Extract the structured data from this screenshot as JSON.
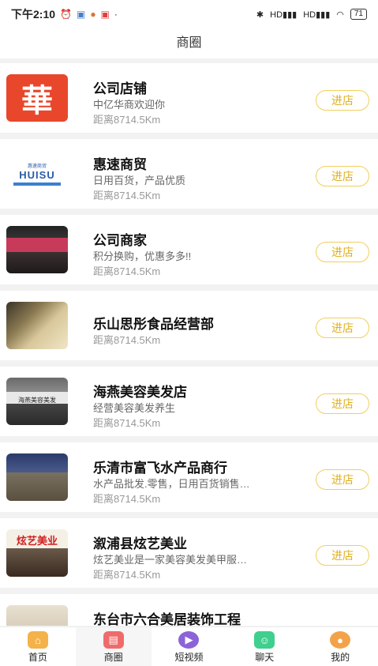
{
  "status_bar": {
    "time": "下午2:10",
    "network": "HD",
    "battery": "71"
  },
  "header": {
    "title": "商圈"
  },
  "stores": [
    {
      "name": "公司店铺",
      "desc": "中亿华商欢迎你",
      "distance": "距离8714.5Km",
      "button": "进店"
    },
    {
      "name": "惠速商贸",
      "desc": "日用百货，产品优质",
      "distance": "距离8714.5Km",
      "button": "进店"
    },
    {
      "name": "公司商家",
      "desc": "积分换购，优惠多多!!",
      "distance": "距离8714.5Km",
      "button": "进店"
    },
    {
      "name": "乐山思彤食品经营部",
      "desc": "",
      "distance": "距离8714.5Km",
      "button": "进店"
    },
    {
      "name": "海燕美容美发店",
      "desc": "经营美容美发养生",
      "distance": "距离8714.5Km",
      "button": "进店"
    },
    {
      "name": "乐清市富飞水产品商行",
      "desc": "水产品批发.零售，日用百货销售…",
      "distance": "距离8714.5Km",
      "button": "进店"
    },
    {
      "name": "溆浦县炫艺美业",
      "desc": "炫艺美业是一家美容美发美甲服…",
      "distance": "距离8714.5Km",
      "button": "进店"
    },
    {
      "name": "东台市六合美居装饰工程",
      "desc": "",
      "distance": "",
      "button": ""
    }
  ],
  "thumb_text": {
    "logo1": "華",
    "logo2_small": "惠速商贸",
    "logo2_big": "HUISU",
    "sign": "炫艺美业",
    "sign2": "海燕美容美发"
  },
  "tabs": [
    {
      "label": "首页",
      "icon": "home-icon",
      "color": "#f4b24a"
    },
    {
      "label": "商圈",
      "icon": "shop-icon",
      "color": "#ef6b6b",
      "active": true
    },
    {
      "label": "短视频",
      "icon": "video-icon",
      "color": "#8c63d8"
    },
    {
      "label": "聊天",
      "icon": "chat-icon",
      "color": "#3fcf8e"
    },
    {
      "label": "我的",
      "icon": "profile-icon",
      "color": "#f2a34a"
    }
  ]
}
